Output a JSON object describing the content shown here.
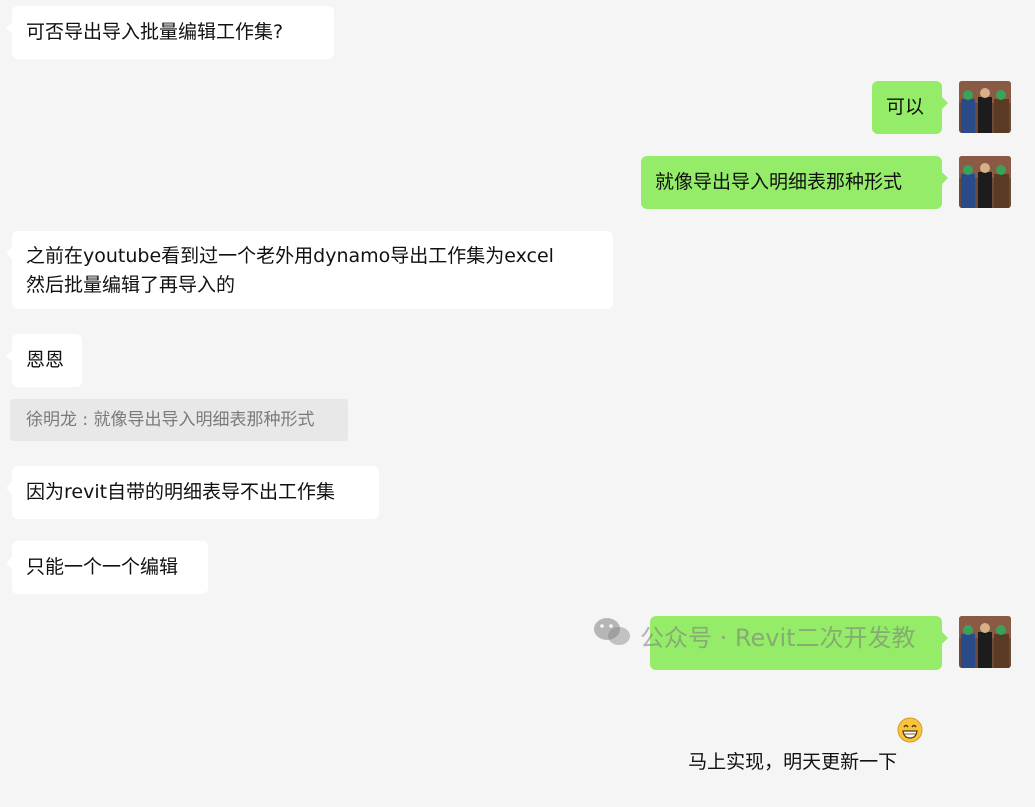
{
  "messages": [
    {
      "side": "left",
      "text": "可否导出导入批量编辑工作集?"
    },
    {
      "side": "right",
      "text": "可以"
    },
    {
      "side": "right",
      "text": "就像导出导入明细表那种形式"
    },
    {
      "side": "left",
      "text": "之前在youtube看到过一个老外用dynamo导出工作集为excel\n然后批量编辑了再导入的"
    },
    {
      "side": "left",
      "text": "恩恩"
    },
    {
      "side": "left",
      "text": "因为revit自带的明细表导不出工作集"
    },
    {
      "side": "left",
      "text": "只能一个一个编辑"
    },
    {
      "side": "right",
      "text": "马上实现，明天更新一下"
    }
  ],
  "quote": {
    "author": "徐明龙",
    "separator": " : ",
    "text": "就像导出导入明细表那种形式"
  },
  "watermark": {
    "text": "公众号 · Revit二次开发教"
  },
  "colors": {
    "background": "#f5f5f5",
    "incoming_bubble": "#ffffff",
    "outgoing_bubble": "#95ec69",
    "quote_bg": "#e8e8e8"
  },
  "icons": {
    "emoji": "grinning-face-icon",
    "watermark": "wechat-logo-icon",
    "avatar": "user-avatar-icon"
  }
}
